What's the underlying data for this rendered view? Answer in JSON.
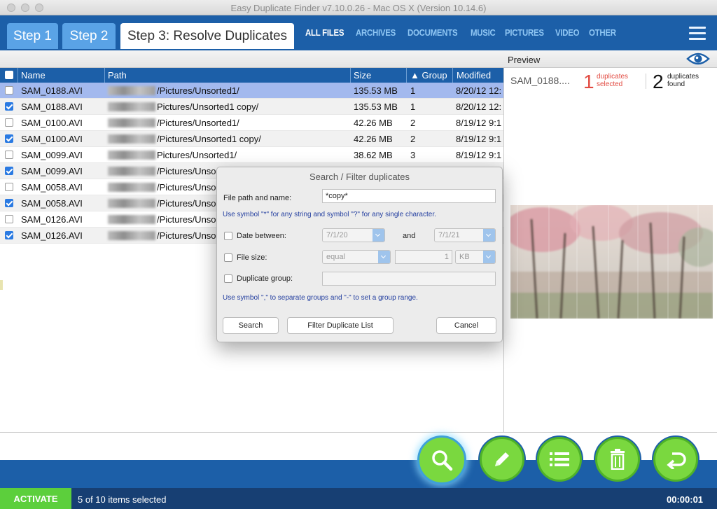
{
  "window": {
    "title": "Easy Duplicate Finder v7.10.0.26 - Mac OS X (Version 10.14.6)"
  },
  "steps": [
    {
      "label": "Step 1"
    },
    {
      "label": "Step 2"
    },
    {
      "label": "Step 3: Resolve Duplicates"
    }
  ],
  "categories": [
    "ALL FILES",
    "ARCHIVES",
    "DOCUMENTS",
    "MUSIC",
    "PICTURES",
    "VIDEO",
    "OTHER"
  ],
  "preview": {
    "label": "Preview",
    "file_name": "SAM_0188....",
    "dup_selected_count": "1",
    "dup_selected_line1": "duplicates",
    "dup_selected_line2": "selected",
    "dup_found_count": "2",
    "dup_found_line1": "duplicates",
    "dup_found_line2": "found"
  },
  "table": {
    "headers": {
      "name": "Name",
      "path": "Path",
      "size": "Size",
      "group": "▲ Group",
      "modified": "Modified"
    },
    "rows": [
      {
        "name": "SAM_0188.AVI",
        "path": "/Pictures/Unsorted1/",
        "size": "135.53 MB",
        "group": "1",
        "modified": "8/20/12 12:",
        "checked": false
      },
      {
        "name": "SAM_0188.AVI",
        "path": "Pictures/Unsorted1 copy/",
        "size": "135.53 MB",
        "group": "1",
        "modified": "8/20/12 12:",
        "checked": true
      },
      {
        "name": "SAM_0100.AVI",
        "path": "/Pictures/Unsorted1/",
        "size": "42.26 MB",
        "group": "2",
        "modified": "8/19/12 9:1",
        "checked": false
      },
      {
        "name": "SAM_0100.AVI",
        "path": "/Pictures/Unsorted1 copy/",
        "size": "42.26 MB",
        "group": "2",
        "modified": "8/19/12 9:1",
        "checked": true
      },
      {
        "name": "SAM_0099.AVI",
        "path": "Pictures/Unsorted1/",
        "size": "38.62 MB",
        "group": "3",
        "modified": "8/19/12 9:1",
        "checked": false
      },
      {
        "name": "SAM_0099.AVI",
        "path": "/Pictures/Unsor",
        "size": "",
        "group": "",
        "modified": "",
        "checked": true
      },
      {
        "name": "SAM_0058.AVI",
        "path": "/Pictures/Unsor",
        "size": "",
        "group": "",
        "modified": "",
        "checked": false
      },
      {
        "name": "SAM_0058.AVI",
        "path": "/Pictures/Unsor",
        "size": "",
        "group": "",
        "modified": "",
        "checked": true
      },
      {
        "name": "SAM_0126.AVI",
        "path": "/Pictures/Unsor",
        "size": "",
        "group": "",
        "modified": "",
        "checked": false
      },
      {
        "name": "SAM_0126.AVI",
        "path": "/Pictures/Unsor",
        "size": "",
        "group": "",
        "modified": "",
        "checked": true
      }
    ]
  },
  "dialog": {
    "title": "Search / Filter duplicates",
    "file_path_label": "File path and name:",
    "file_path_value": "*copy*",
    "wildcard_hint": "Use symbol \"*\" for any string and symbol \"?\" for any single character.",
    "date_label": "Date between:",
    "date_from": "7/1/20",
    "date_and": "and",
    "date_to": "7/1/21",
    "size_label": "File size:",
    "size_op": "equal",
    "size_value": "1",
    "size_unit": "KB",
    "group_label": "Duplicate group:",
    "group_hint": "Use symbol \",\" to separate groups and \"-\" to set a group range.",
    "btn_search": "Search",
    "btn_filter": "Filter Duplicate List",
    "btn_cancel": "Cancel"
  },
  "status": {
    "activate": "ACTIVATE",
    "selected": "5 of 10 items selected",
    "timer": "00:00:01"
  },
  "colors": {
    "brand_blue": "#1c5fa8",
    "accent_green": "#7ad83f",
    "highlight_row": "#a3b9ee",
    "dup_red": "#e24b42"
  },
  "icons": [
    "search-icon",
    "pencil-icon",
    "list-icon",
    "trash-icon",
    "undo-icon",
    "eye-icon",
    "hamburger-menu-icon"
  ]
}
